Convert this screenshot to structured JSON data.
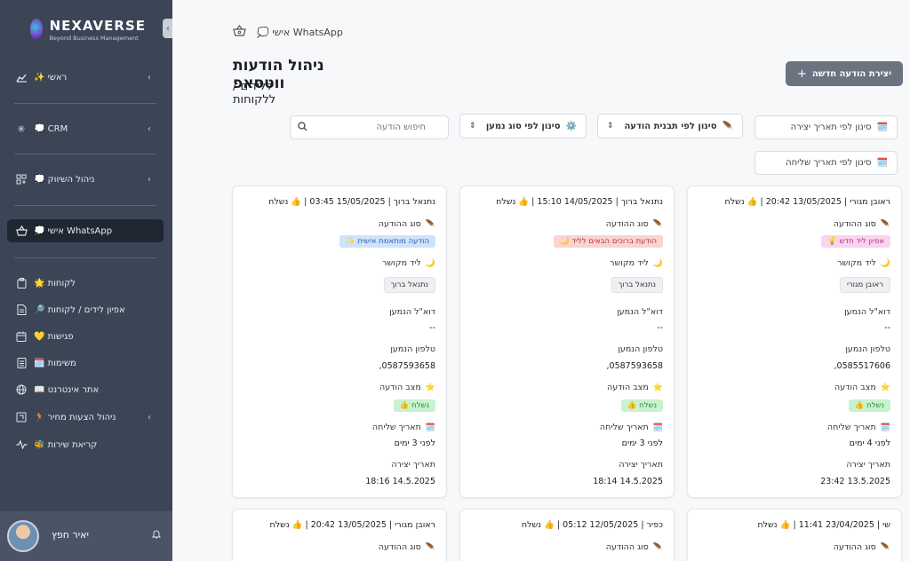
{
  "sidebar": {
    "logo_name": "NEXAVERSE",
    "logo_tagline": "Beyond Business Management",
    "items": [
      {
        "label": "ראשי ✨",
        "icon": "chart-icon",
        "chevron": true
      },
      {
        "label": "CRM 💭",
        "icon": "asterisk-icon",
        "chevron": true
      },
      {
        "label": "ניהול השיווק 💭",
        "icon": "grid-icon",
        "chevron": true
      },
      {
        "label": "WhatsApp אישי 💭",
        "icon": "basket-icon",
        "chevron": false,
        "active": true
      },
      {
        "label": "לקוחות 🌟",
        "icon": "clipboard-icon",
        "chevron": false
      },
      {
        "label": "אפיון לידים / לקוחות 🔎",
        "icon": "document-icon",
        "chevron": false
      },
      {
        "label": "פגישות 💛",
        "icon": "calendar-icon",
        "chevron": false
      },
      {
        "label": "משימות 🗓️",
        "icon": "list-icon",
        "chevron": false
      },
      {
        "label": "אתר אינטרנט 📖",
        "icon": "globe-icon",
        "chevron": false
      },
      {
        "label": "ניהול הצעות מחיר 🏃",
        "icon": "quote-icon",
        "chevron": true
      },
      {
        "label": "קריאת שירות 🐝",
        "icon": "pulse-icon",
        "chevron": false
      }
    ],
    "user_name": "יאיר חפץ"
  },
  "header": {
    "breadcrumb": "WhatsApp אישי 💭",
    "title": "ניהול הודעות ווטסאפ",
    "subtitle": "ללידים / ללקוחות",
    "new_button": "יצירת הודעה חדשה"
  },
  "filters": {
    "search_placeholder": "חיפוש הודעה",
    "by_recipient_type": "סינון לפי סוג נמען",
    "by_template": "סינון לפי תבנית הודעה",
    "by_created_date": "סינון לפי תאריך יצירה",
    "by_sent_date": "סינון לפי תאריך שליחה"
  },
  "labels": {
    "msg_type": "סוג ההודעה",
    "linked_lead": "ליד מקושר",
    "recipient_email": "דוא\"ל הנמען",
    "recipient_phone": "טלפון הנמען",
    "msg_status": "מצב הודעה",
    "sent_date": "תאריך שליחה",
    "created_date": "תאריך יצירה"
  },
  "cards": [
    {
      "header": "ראובן מגורי | 13/05/2025 20:42 | 👍 נשלח",
      "type": "אפיון ליד חדש 💡",
      "type_color": "pink",
      "lead": "ראובן מגורי",
      "email": "--",
      "phone": "0585517606,",
      "status": "נשלח 👍",
      "sent": "לפני 4 ימים",
      "created": "13.5.2025 23:42"
    },
    {
      "header": "נתנאל ברוך | 14/05/2025 15:10 | 👍 נשלח",
      "type": "הודעת ברוכים הבאים לליד 🌙",
      "type_color": "red",
      "lead": "נתנאל ברוך",
      "email": "--",
      "phone": "0587593658,",
      "status": "נשלח 👍",
      "sent": "לפני 3 ימים",
      "created": "14.5.2025 18:14"
    },
    {
      "header": "נתנאל ברוך | 15/05/2025 03:45 | 👍 נשלח",
      "type": "הודעה מותאמת אישית ✨",
      "type_color": "blue",
      "lead": "נתנאל ברוך",
      "email": "--",
      "phone": "0587593658,",
      "status": "נשלח 👍",
      "sent": "לפני 3 ימים",
      "created": "14.5.2025 18:16"
    },
    {
      "header": "שי | 23/04/2025 11:41 | 👍 נשלח"
    },
    {
      "header": "כפיר | 12/05/2025 05:12 | 👍 נשלח"
    },
    {
      "header": "ראובן מגורי | 13/05/2025 20:42 | 👍 נשלח"
    }
  ]
}
